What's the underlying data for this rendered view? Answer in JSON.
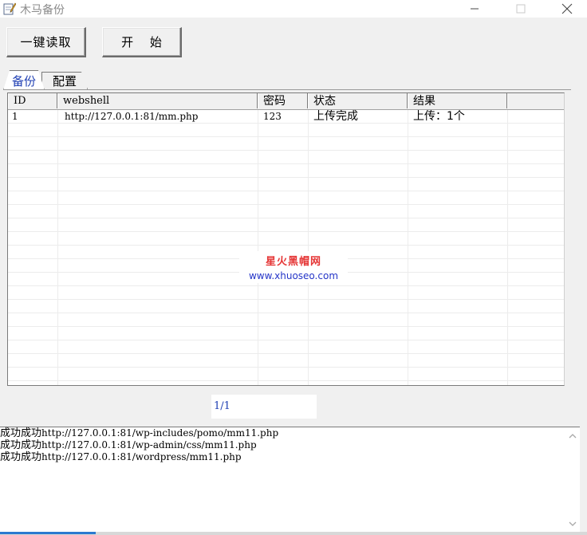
{
  "window": {
    "title": "木马备份",
    "minimize": "─",
    "maximize": "☐",
    "close": "✕",
    "app_icon": "pencil-notepad-icon"
  },
  "toolbar": {
    "read_label": "一键读取",
    "start_label": "开 始"
  },
  "tabs": [
    {
      "label": "备份",
      "active": true
    },
    {
      "label": "配置",
      "active": false
    }
  ],
  "grid": {
    "columns": [
      "ID",
      "webshell",
      "密码",
      "状态",
      "结果",
      ""
    ],
    "rows": [
      {
        "id": "1",
        "webshell": "http://127.0.0.1:81/mm.php",
        "password": "123",
        "status": "上传完成",
        "result": "上传：1个"
      }
    ],
    "empty_row_count": 20
  },
  "watermark": {
    "title": "星火黑帽网",
    "url": "www.xhuoseo.com"
  },
  "pager": {
    "text": "1/1"
  },
  "log": {
    "lines": [
      {
        "prefix": "成功成功",
        "url": "http://127.0.0.1:81/wp-includes/pomo/mm11.php"
      },
      {
        "prefix": "成功成功",
        "url": "http://127.0.0.1:81/wp-admin/css/mm11.php"
      },
      {
        "prefix": "成功成功",
        "url": "http://127.0.0.1:81/wordpress/mm11.php"
      }
    ]
  },
  "colors": {
    "active_tab_text": "#1f3fb3",
    "watermark_title": "#e53535",
    "watermark_url": "#2535c8",
    "pager_text": "#1f3fb3"
  }
}
